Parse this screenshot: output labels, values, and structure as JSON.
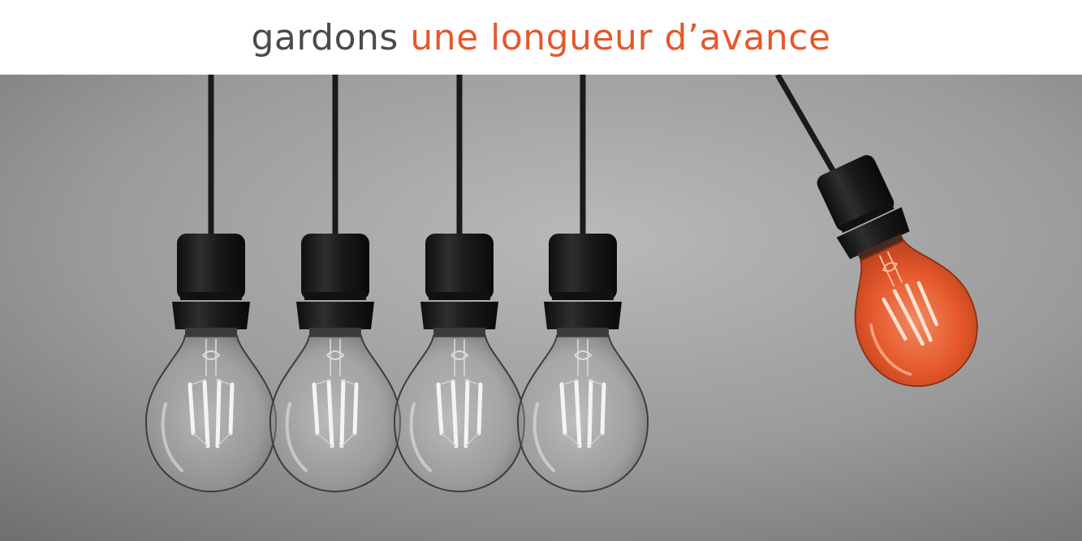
{
  "headline": {
    "part_a": "gardons",
    "part_b": "une longueur d’avance"
  },
  "colors": {
    "text_gray": "#4a4a4a",
    "accent_orange": "#e5582b",
    "background_gray": "#8f8f8f",
    "socket_black": "#1c1c1c"
  },
  "photo": {
    "subject": "five hanging light bulbs",
    "bulb_count": 5,
    "highlighted_bulb_color": "#e5582b"
  }
}
